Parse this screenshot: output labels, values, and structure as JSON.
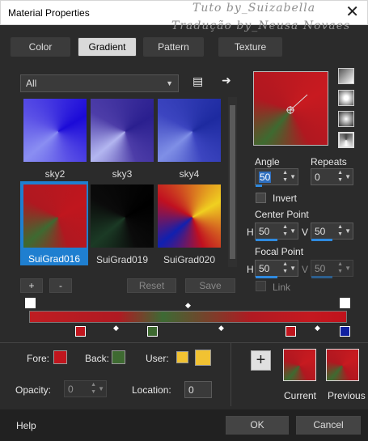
{
  "window": {
    "title": "Material Properties",
    "close_glyph": "✕"
  },
  "watermark": {
    "line1": "Tuto by_Suizabella",
    "line2": "Tradução by_Neusa Novaes"
  },
  "tabs": [
    "Color",
    "Gradient",
    "Pattern",
    "Texture"
  ],
  "active_tab": "Gradient",
  "category": {
    "value": "All"
  },
  "gradients": [
    {
      "name": "sky2",
      "colors": [
        "#1b0ad8",
        "#8a8ef2",
        "#5a50e6"
      ]
    },
    {
      "name": "sky3",
      "colors": [
        "#2a1f8f",
        "#b3b6f0",
        "#4d3da8"
      ]
    },
    {
      "name": "sky4",
      "colors": [
        "#1d2aa0",
        "#7f8fe6",
        "#3c45c0"
      ]
    },
    {
      "name": "SuiGrad016",
      "colors": [
        "#c0161e",
        "#3e6a31",
        "#b01820"
      ],
      "selected": true
    },
    {
      "name": "SuiGrad019",
      "colors": [
        "#000000",
        "#1b3a25",
        "#0b0b0b"
      ]
    },
    {
      "name": "SuiGrad020",
      "colors": [
        "#f0d020",
        "#1020b0",
        "#c01020"
      ]
    }
  ],
  "list_buttons": {
    "add": "+",
    "remove": "-",
    "reset": "Reset",
    "save": "Save"
  },
  "style_icons": [
    "linear-style-icon",
    "rectangular-style-icon",
    "sunburst-style-icon",
    "radial-style-icon"
  ],
  "angle": {
    "label": "Angle",
    "value": "50"
  },
  "repeats": {
    "label": "Repeats",
    "value": "0"
  },
  "invert": {
    "label": "Invert",
    "checked": false
  },
  "center_point": {
    "label": "Center Point",
    "h_label": "H",
    "h": "50",
    "v_label": "V",
    "v": "50"
  },
  "focal_point": {
    "label": "Focal Point",
    "h_label": "H",
    "h": "50",
    "v_label": "V",
    "v": "50"
  },
  "link": {
    "label": "Link",
    "checked": false
  },
  "editor": {
    "midpoint_marker": "◆",
    "stop_marker": "▼"
  },
  "fore": {
    "label": "Fore:",
    "color": "#c0161e"
  },
  "back": {
    "label": "Back:",
    "color": "#3e6a31"
  },
  "user": {
    "label": "User:",
    "color": "#f1c232"
  },
  "opacity": {
    "label": "Opacity:",
    "value": "0"
  },
  "location": {
    "label": "Location:",
    "value": "0"
  },
  "add_swatch": "+",
  "current": {
    "label": "Current"
  },
  "previous": {
    "label": "Previous"
  },
  "footer": {
    "help": "Help",
    "ok": "OK",
    "cancel": "Cancel"
  }
}
